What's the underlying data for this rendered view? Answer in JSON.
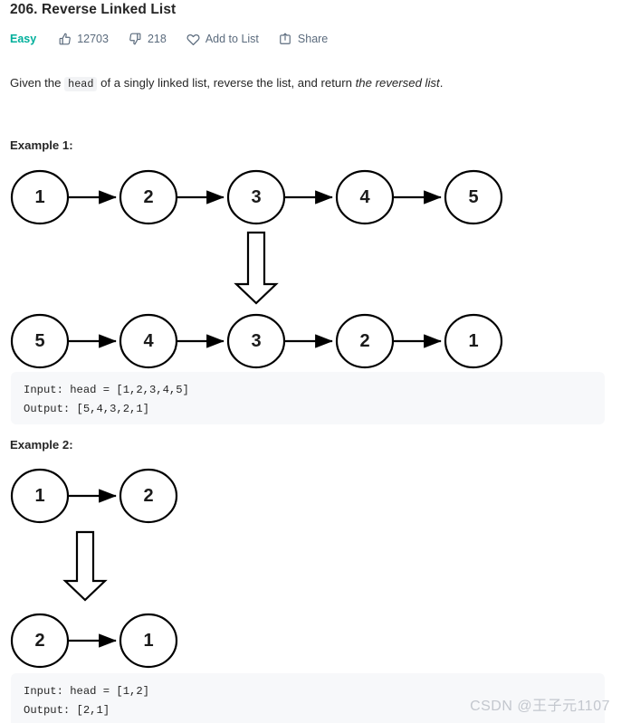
{
  "header": {
    "title": "206. Reverse Linked List",
    "difficulty": "Easy",
    "difficulty_color": "#00af9b",
    "likes_icon": "thumbs-up-icon",
    "likes": "12703",
    "dislikes_icon": "thumbs-down-icon",
    "dislikes": "218",
    "add_to_list_icon": "heart-icon",
    "add_to_list_label": "Add to List",
    "share_icon": "share-icon",
    "share_label": "Share"
  },
  "description": {
    "part1": "Given the ",
    "code": "head",
    "part2": " of a singly linked list, reverse the list, and return ",
    "emphasis": "the reversed list",
    "part3": "."
  },
  "examples": [
    {
      "heading": "Example 1:",
      "input_nodes": [
        "1",
        "2",
        "3",
        "4",
        "5"
      ],
      "output_nodes": [
        "5",
        "4",
        "3",
        "2",
        "1"
      ],
      "arrow_icon": "down-block-arrow-icon",
      "input_line": "Input: head = [1,2,3,4,5]",
      "output_line": "Output: [5,4,3,2,1]"
    },
    {
      "heading": "Example 2:",
      "input_nodes": [
        "1",
        "2"
      ],
      "output_nodes": [
        "2",
        "1"
      ],
      "arrow_icon": "down-block-arrow-icon",
      "input_line": "Input: head = [1,2]",
      "output_line": "Output: [2,1]"
    }
  ],
  "watermark": {
    "text": "CSDN @王子元1107",
    "color": "#c3c7ce"
  },
  "theme": {
    "background": "#ffffff",
    "text": "#262626",
    "muted": "#5b6b7d",
    "code_background": "#f7f8fa",
    "inline_code_background": "#f2f3f5",
    "diagram_stroke": "#000000"
  }
}
